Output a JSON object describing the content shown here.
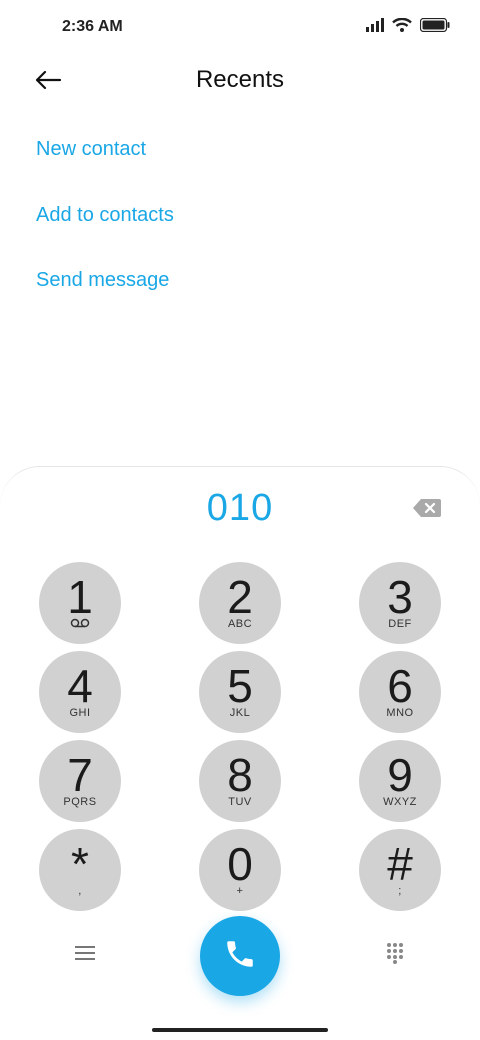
{
  "status_bar": {
    "time": "2:36 AM",
    "icons": [
      "signal-icon",
      "wifi-icon",
      "battery-icon"
    ]
  },
  "header": {
    "back_icon": "arrow-left-icon",
    "title": "Recents"
  },
  "actions": {
    "new_contact": "New contact",
    "add_to_contacts": "Add to contacts",
    "send_message": "Send message"
  },
  "dialer": {
    "number": "010",
    "backspace_icon": "backspace-icon",
    "keys": [
      {
        "digit": "1",
        "sub": "voicemail-icon"
      },
      {
        "digit": "2",
        "sub": "ABC"
      },
      {
        "digit": "3",
        "sub": "DEF"
      },
      {
        "digit": "4",
        "sub": "GHI"
      },
      {
        "digit": "5",
        "sub": "JKL"
      },
      {
        "digit": "6",
        "sub": "MNO"
      },
      {
        "digit": "7",
        "sub": "PQRS"
      },
      {
        "digit": "8",
        "sub": "TUV"
      },
      {
        "digit": "9",
        "sub": "WXYZ"
      },
      {
        "digit": "*",
        "sub": ","
      },
      {
        "digit": "0",
        "sub": "+"
      },
      {
        "digit": "#",
        "sub": ";"
      }
    ],
    "bottom": {
      "menu_icon": "menu-icon",
      "call_icon": "phone-icon",
      "keypad_icon": "keypad-icon"
    }
  },
  "colors": {
    "accent": "#1aa7e6",
    "key_bg": "#d1d1d1"
  }
}
